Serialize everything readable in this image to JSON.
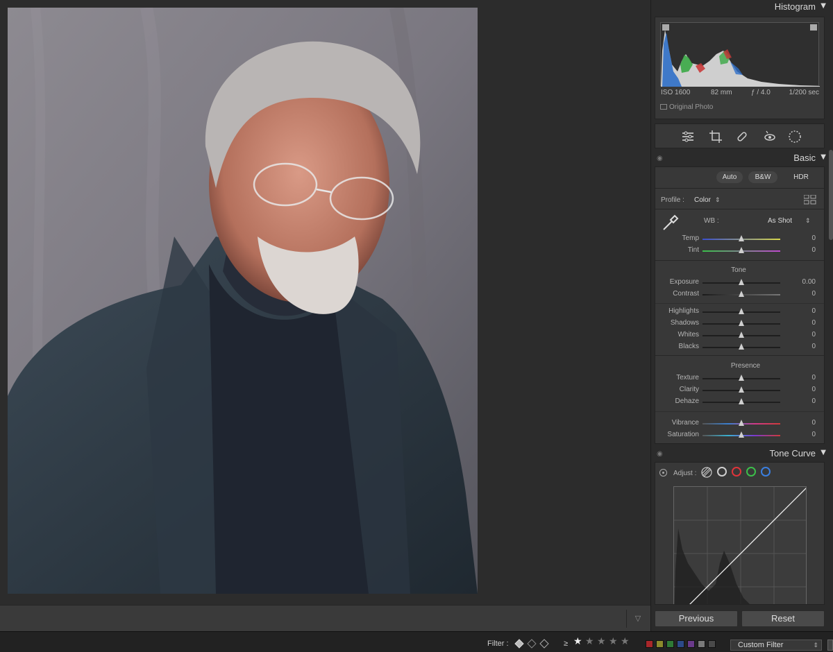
{
  "histogram": {
    "title": "Histogram",
    "iso": "ISO 1600",
    "focal": "82 mm",
    "aperture": "ƒ / 4.0",
    "shutter": "1/200 sec",
    "original_photo": "Original Photo"
  },
  "tools": [
    "edit-sliders-icon",
    "crop-icon",
    "healing-icon",
    "red-eye-icon",
    "masking-icon"
  ],
  "basic": {
    "title": "Basic",
    "auto": "Auto",
    "bw": "B&W",
    "hdr": "HDR",
    "profile_label": "Profile :",
    "profile_value": "Color",
    "wb_label": "WB :",
    "wb_value": "As Shot",
    "temp": {
      "label": "Temp",
      "value": "0"
    },
    "tint": {
      "label": "Tint",
      "value": "0"
    },
    "tone_title": "Tone",
    "exposure": {
      "label": "Exposure",
      "value": "0.00"
    },
    "contrast": {
      "label": "Contrast",
      "value": "0"
    },
    "highlights": {
      "label": "Highlights",
      "value": "0"
    },
    "shadows": {
      "label": "Shadows",
      "value": "0"
    },
    "whites": {
      "label": "Whites",
      "value": "0"
    },
    "blacks": {
      "label": "Blacks",
      "value": "0"
    },
    "presence_title": "Presence",
    "texture": {
      "label": "Texture",
      "value": "0"
    },
    "clarity": {
      "label": "Clarity",
      "value": "0"
    },
    "dehaze": {
      "label": "Dehaze",
      "value": "0"
    },
    "vibrance": {
      "label": "Vibrance",
      "value": "0"
    },
    "saturation": {
      "label": "Saturation",
      "value": "0"
    }
  },
  "tone_curve": {
    "title": "Tone Curve",
    "adjust_label": "Adjust :",
    "channels": [
      "parametric",
      "point-white",
      "red",
      "green",
      "blue"
    ],
    "channel_colors": {
      "white": "#d0d0d0",
      "red": "#e0343a",
      "green": "#3cbf4a",
      "blue": "#3a7fe0"
    }
  },
  "buttons": {
    "previous": "Previous",
    "reset": "Reset"
  },
  "filterbar": {
    "filter_label": "Filter :",
    "rating_op": "≥",
    "stars": 1,
    "color_labels": [
      "#a8272a",
      "#8c8a2c",
      "#2f7a36",
      "#2c4a8a",
      "#6a3a8a",
      "#7a7a7a",
      "#4a4a4a"
    ],
    "custom_filter": "Custom Filter"
  }
}
